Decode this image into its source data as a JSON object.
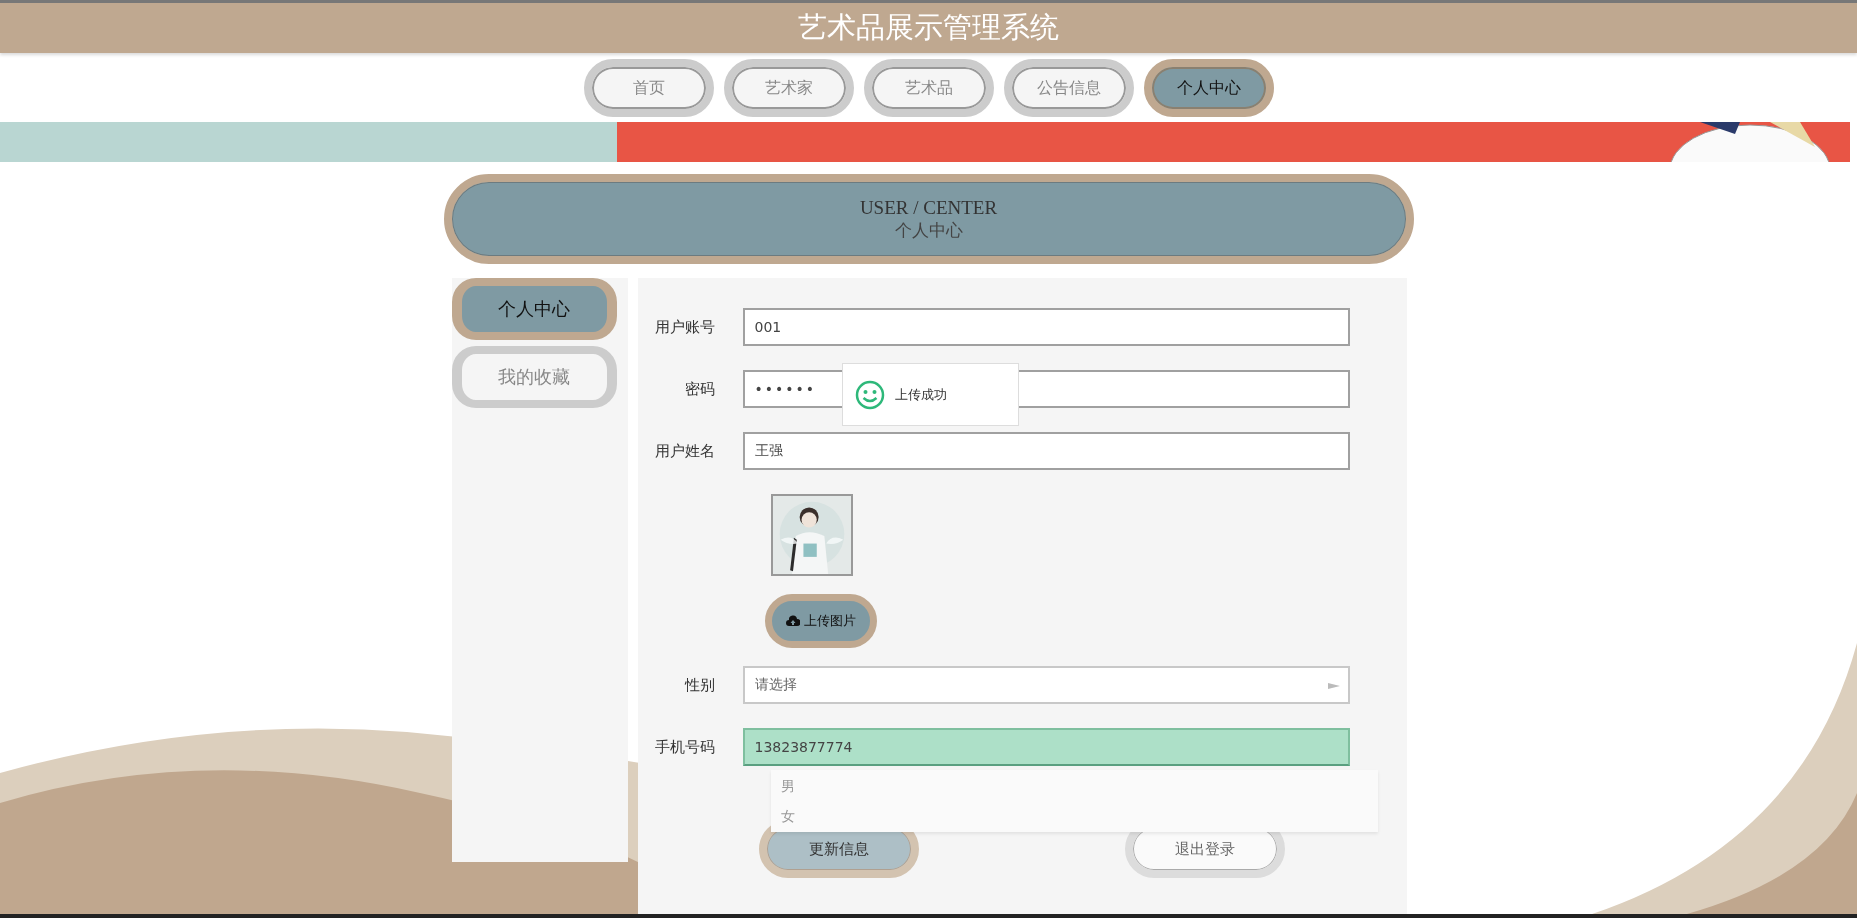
{
  "header": {
    "title": "艺术品展示管理系统"
  },
  "nav": [
    {
      "label": "首页",
      "selected": false
    },
    {
      "label": "艺术家",
      "selected": false
    },
    {
      "label": "艺术品",
      "selected": false
    },
    {
      "label": "公告信息",
      "selected": false
    },
    {
      "label": "个人中心",
      "selected": true
    }
  ],
  "section_title": {
    "english": "USER / CENTER",
    "chinese": "个人中心"
  },
  "sidebar": {
    "items": [
      {
        "label": "个人中心",
        "selected": true
      },
      {
        "label": "我的收藏",
        "selected": false
      }
    ]
  },
  "form": {
    "fields": [
      {
        "label": "用户账号",
        "kind": "text",
        "value": "001"
      },
      {
        "label": "密码",
        "kind": "password",
        "value": "••••••"
      },
      {
        "label": "用户姓名",
        "kind": "text",
        "value": "王强"
      }
    ],
    "upload_button": "上传图片",
    "gender": {
      "label": "性别",
      "placeholder": "请选择",
      "expanded": true,
      "options": [
        {
          "label": "男",
          "selected": false
        },
        {
          "label": "女",
          "selected": false
        }
      ]
    },
    "phone": {
      "label": "手机号码",
      "value": "13823877774",
      "highlighted": true
    },
    "buttons": [
      {
        "label": "更新信息",
        "kind": "primary"
      },
      {
        "label": "退出登录",
        "kind": "secondary"
      }
    ]
  },
  "toast": {
    "message": "上传成功"
  }
}
